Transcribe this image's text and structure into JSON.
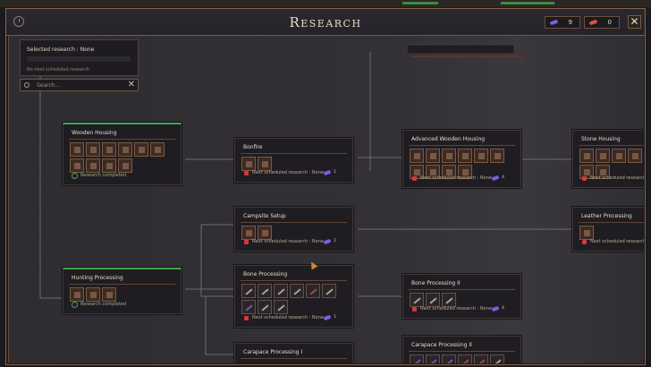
{
  "window": {
    "title": "Research",
    "resources": [
      {
        "value": "9",
        "color": "#7b5fe0"
      },
      {
        "value": "0",
        "color": "#d05a3a"
      }
    ]
  },
  "selected": {
    "label": "Selected research : None",
    "sub": "No next scheduled research"
  },
  "search": {
    "placeholder": "Search..."
  },
  "texts": {
    "completed": "Research completed",
    "next": "Next scheduled research : None"
  },
  "nodes": [
    {
      "id": "wooden-housing",
      "title": "Wooden Housing",
      "status": "completed"
    },
    {
      "id": "bonfire",
      "title": "Bonfire",
      "status": "locked",
      "cost": "1"
    },
    {
      "id": "advanced-wooden-housing",
      "title": "Advanced Wooden Housing",
      "status": "locked",
      "cost": "4"
    },
    {
      "id": "stone-housing",
      "title": "Stone Housing",
      "status": "locked"
    },
    {
      "id": "campsite-setup",
      "title": "Campsite Setup",
      "status": "locked",
      "cost": "1"
    },
    {
      "id": "leather-processing",
      "title": "Leather Processing",
      "status": "locked"
    },
    {
      "id": "hunting-processing",
      "title": "Hunting Processing",
      "status": "completed"
    },
    {
      "id": "bone-processing",
      "title": "Bone Processing",
      "status": "locked",
      "cost": "1"
    },
    {
      "id": "bone-processing-ii",
      "title": "Bone Processing II",
      "status": "locked",
      "cost": "4"
    },
    {
      "id": "carapace-processing-i",
      "title": "Carapace Processing I",
      "status": "locked"
    },
    {
      "id": "carapace-processing-ii",
      "title": "Carapace Processing II",
      "status": "locked"
    }
  ]
}
